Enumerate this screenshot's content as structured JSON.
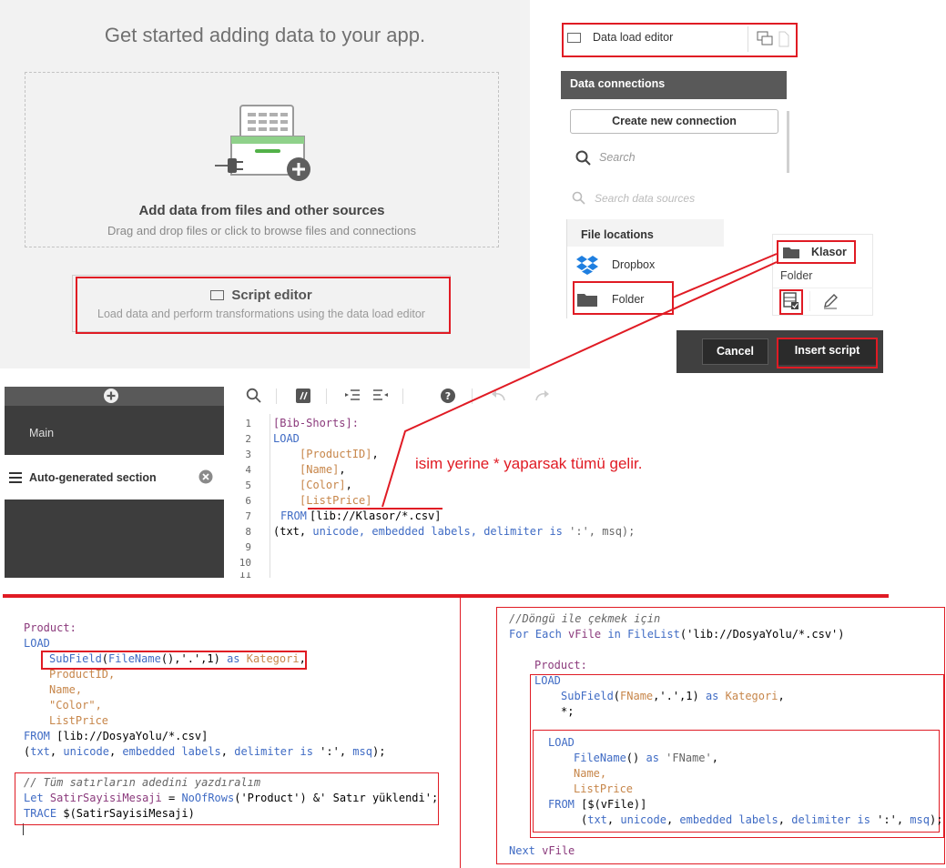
{
  "add_panel": {
    "title": "Get started adding data to your app.",
    "drop_heading": "Add data from files and other sources",
    "drop_sub": "Drag and drop files or click to browse files and connections",
    "script_heading": "Script editor",
    "script_sub": "Load data and perform transformations using the data load editor"
  },
  "dle_header": {
    "label": "Data load editor"
  },
  "data_connections": {
    "header": "Data connections",
    "create_button": "Create new connection",
    "search_placeholder": "Search",
    "search_sources": "Search data sources",
    "file_locations": "File locations",
    "items": [
      "Dropbox",
      "Folder"
    ]
  },
  "klasor_card": {
    "name": "Klasor",
    "type": "Folder"
  },
  "dialog": {
    "cancel": "Cancel",
    "insert": "Insert script"
  },
  "editor_sidebar": {
    "main": "Main",
    "section": "Auto-generated section"
  },
  "annotation": "isim yerine * yaparsak tümü gelir.",
  "editor_lines": [
    "1",
    "2",
    "3",
    "4",
    "5",
    "6",
    "7",
    "8",
    "9",
    "10",
    "11"
  ],
  "editor_code": {
    "l1": "[Bib-Shorts]:",
    "l2": "LOAD",
    "l3": "[ProductID]",
    "l4": "[Name]",
    "l5": "[Color]",
    "l6": "[ListPrice]",
    "l7_kw": "FROM",
    "l7_path": "[lib://Klasor/*.csv]",
    "l8_a": "(txt, ",
    "l8_b": "unicode, embedded labels, delimiter is",
    "l8_c": " ':', msq);"
  },
  "code_left": {
    "label": "Product:",
    "load": "LOAD",
    "subfield": "SubField(FileName(),'.',1) as Kategori,",
    "f1": "ProductID,",
    "f2": "Name,",
    "f3": "\"Color\",",
    "f4": "ListPrice",
    "from": "FROM [lib://DosyaYolu/*.csv]",
    "format": "(txt, unicode, embedded labels, delimiter is ':', msq);",
    "comment": "// Tüm satırların adedini yazdıralım",
    "let": "Let SatirSayisiMesaji = NoOfRows('Product') &' Satır yüklendi';",
    "trace": "TRACE $(SatirSayisiMesaji)"
  },
  "code_right": {
    "comment": "//Döngü ile çekmek için",
    "foreach": "For Each vFile in FileList('lib://DosyaYolu/*.csv')",
    "label": "Product:",
    "load1": "LOAD",
    "subfield": "SubField(FName,'.',1) as Kategori,",
    "star": "*;",
    "load2": "LOAD",
    "filename": "FileName() as 'FName',",
    "name": "Name,",
    "listprice": "ListPrice",
    "from": "FROM [$(vFile)]",
    "format": "(txt, unicode, embedded labels, delimiter is ':', msq);",
    "next": "Next vFile"
  }
}
